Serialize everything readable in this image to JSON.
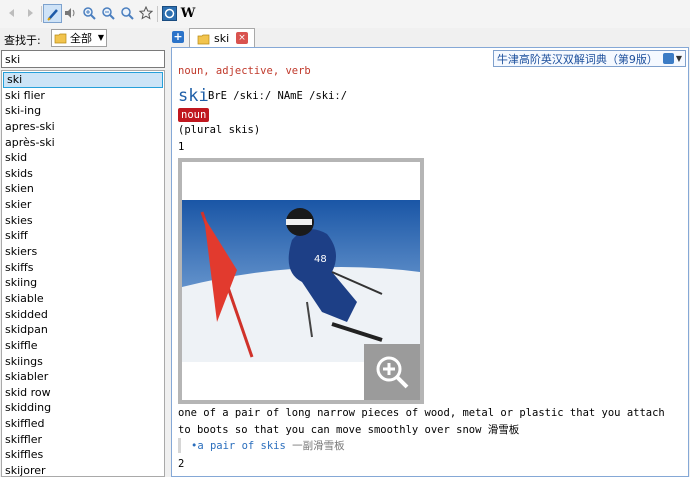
{
  "toolbar": {
    "icons": [
      "back-arrow-icon",
      "forward-arrow-icon",
      "highlighter-icon",
      "speaker-icon",
      "zoom-in-icon",
      "zoom-out-icon",
      "zoom-reset-icon",
      "star-icon",
      "dictionary-app-icon",
      "wikipedia-icon"
    ],
    "wikipedia_glyph": "W"
  },
  "sidebar": {
    "look_in_label": "查找于:",
    "look_in_value": "全部",
    "search_value": "ski",
    "words": [
      "ski",
      "ski flier",
      "ski-ing",
      "apres-ski",
      "après-ski",
      "skid",
      "skids",
      "skien",
      "skier",
      "skies",
      "skiff",
      "skiers",
      "skiffs",
      "skiing",
      "skiable",
      "skidded",
      "skidpan",
      "skiffle",
      "skiings",
      "skiabler",
      "skid row",
      "skidding",
      "skiffled",
      "skiffler",
      "skiffles",
      "skijorer"
    ],
    "selected_index": 0
  },
  "tabs": [
    {
      "label": "ski",
      "close_glyph": "×"
    }
  ],
  "add_tab_glyph": "+",
  "dictionary": {
    "selector_label": "牛津高阶英汉双解词典（第9版）",
    "pos_line": "noun, adjective, verb",
    "headword": "ski",
    "pronunciation": "BrE /skiː/  NAmE /skiː/",
    "pos_badge": "noun",
    "plural": "(plural skis)",
    "sense1_number": "1",
    "definition": "one of a pair of long narrow pieces of wood, metal or plastic that you attach to boots so that you can move smoothly over snow 滑雪板",
    "example_en": "•a pair of skis",
    "example_zh": "一副滑雪板",
    "sense2_number": "2"
  },
  "colors": {
    "accent_blue": "#1f5fa8",
    "badge_red": "#c0171f",
    "selection_bg": "#cce4f7"
  }
}
